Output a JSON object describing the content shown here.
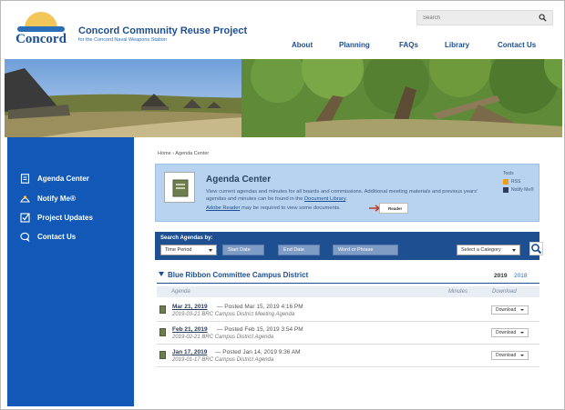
{
  "header": {
    "logo_text": "Concord",
    "title": "Concord Community Reuse Project",
    "subtitle": "for the Concord Naval Weapons Station",
    "search_placeholder": "Search",
    "nav": [
      "About",
      "Planning",
      "FAQs",
      "Library",
      "Contact Us"
    ]
  },
  "sidebar": {
    "items": [
      {
        "label": "Agenda Center",
        "icon": "agenda-icon"
      },
      {
        "label": "Notify Me®",
        "icon": "notify-icon"
      },
      {
        "label": "Project Updates",
        "icon": "checklist-icon"
      },
      {
        "label": "Contact Us",
        "icon": "chat-icon"
      }
    ]
  },
  "breadcrumb": "Home › Agenda Center",
  "card": {
    "title": "Agenda Center",
    "description": "View current agendas and minutes for all boards and commissions. Additional meeting materials and previous years' agendas and minutes can be found in the",
    "library_link": "Document Library",
    "reader_link": "Adobe Reader",
    "reader_text": "may be required to view some documents.",
    "reader_button": "Reader",
    "tools_label": "Tools",
    "tools": [
      "RSS",
      "Notify Me®"
    ]
  },
  "search_bar": {
    "label": "Search Agendas by:",
    "time_period": "Time Period",
    "start_date": "Start Date",
    "end_date": "End Date",
    "words": "Word or Phrase",
    "category": "Select a Category"
  },
  "section": {
    "title": "Blue Ribbon Committee Campus District",
    "years": [
      "2019",
      "2018"
    ]
  },
  "table": {
    "headers": [
      "Agenda",
      "Minutes",
      "Download"
    ],
    "rows": [
      {
        "date": "Mar 21, 2019",
        "posted": "— Posted Mar 15, 2019 4:16 PM",
        "title": "2019-03-21 BRC Campus District Meeting Agenda",
        "download": "Download"
      },
      {
        "date": "Feb 21, 2019",
        "posted": "— Posted Feb 15, 2019 3:54 PM",
        "title": "2019-02-21 BRC Campus District Agenda",
        "download": "Download"
      },
      {
        "date": "Jan 17, 2019",
        "posted": "— Posted Jan 14, 2019 9:36 AM",
        "title": "2019-01-17 BRC Campus District Agenda",
        "download": "Download"
      }
    ]
  },
  "colors": {
    "brand_blue": "#1d4f91",
    "sidebar_blue": "#1258b7",
    "card_blue": "#b8d3ef"
  }
}
